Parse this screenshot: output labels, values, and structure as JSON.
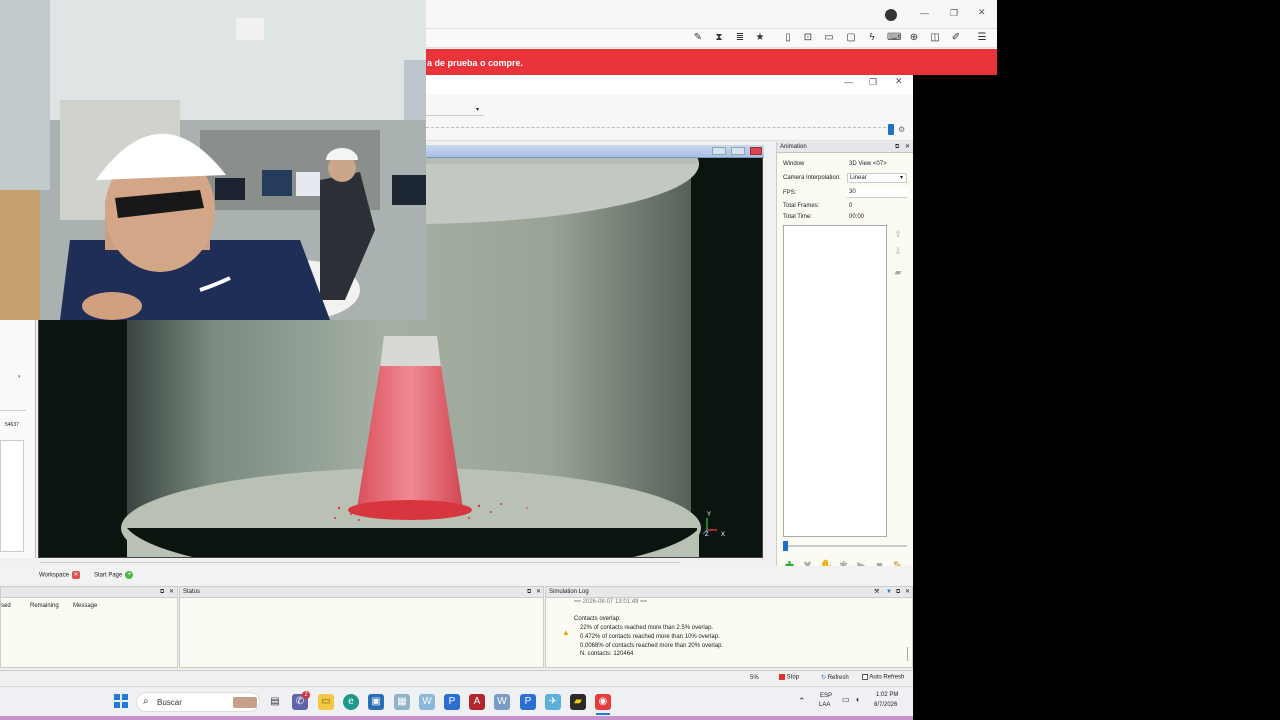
{
  "browser": {
    "trial_banner": "a de prueba o compre."
  },
  "anim_panel": {
    "title": "Animation",
    "fields": [
      {
        "label": "Window",
        "value": "3D View <07>"
      },
      {
        "label": "Camera Interpolation:",
        "value": "Linear"
      },
      {
        "label": "FPS:",
        "value": "30"
      },
      {
        "label": "Total Frames:",
        "value": "0"
      },
      {
        "label": "Total Time:",
        "value": "00:00"
      }
    ]
  },
  "left_panel": {
    "value": "54637"
  },
  "tabs": {
    "workspace": "Workspace",
    "start_page": "Start Page"
  },
  "panels": {
    "tasks_cols": [
      "sed",
      "Remaining",
      "Message"
    ],
    "status_title": "Status",
    "simlog_title": "Simulation Log",
    "log_date": "== 2026-08-07 13:01:49 ==",
    "log_heading": "Contacts overlap:",
    "log_lines": [
      "22% of contacts reached more than 2.5% overlap.",
      "0.472% of contacts reached more than 10% overlap.",
      "0.0068% of contacts reached more than 20% overlap.",
      "N. contacts: 120464"
    ]
  },
  "statusbar": {
    "percent": "5%",
    "stop": "Stop",
    "refresh": "Refresh",
    "auto_refresh": "Auto Refresh"
  },
  "taskbar": {
    "search_placeholder": "Buscar",
    "lang_top": "ESP",
    "lang_bottom": "LAA",
    "time": "1:02 PM",
    "date": "8/7/2026",
    "teams_badge": "2"
  },
  "viewport": {
    "axis_y": "Y",
    "axis_z": "Z",
    "axis_x": "X"
  },
  "colors": {
    "banner_red": "#e8333b",
    "particle_red": "#e05560",
    "accent_blue": "#1a73c9"
  }
}
